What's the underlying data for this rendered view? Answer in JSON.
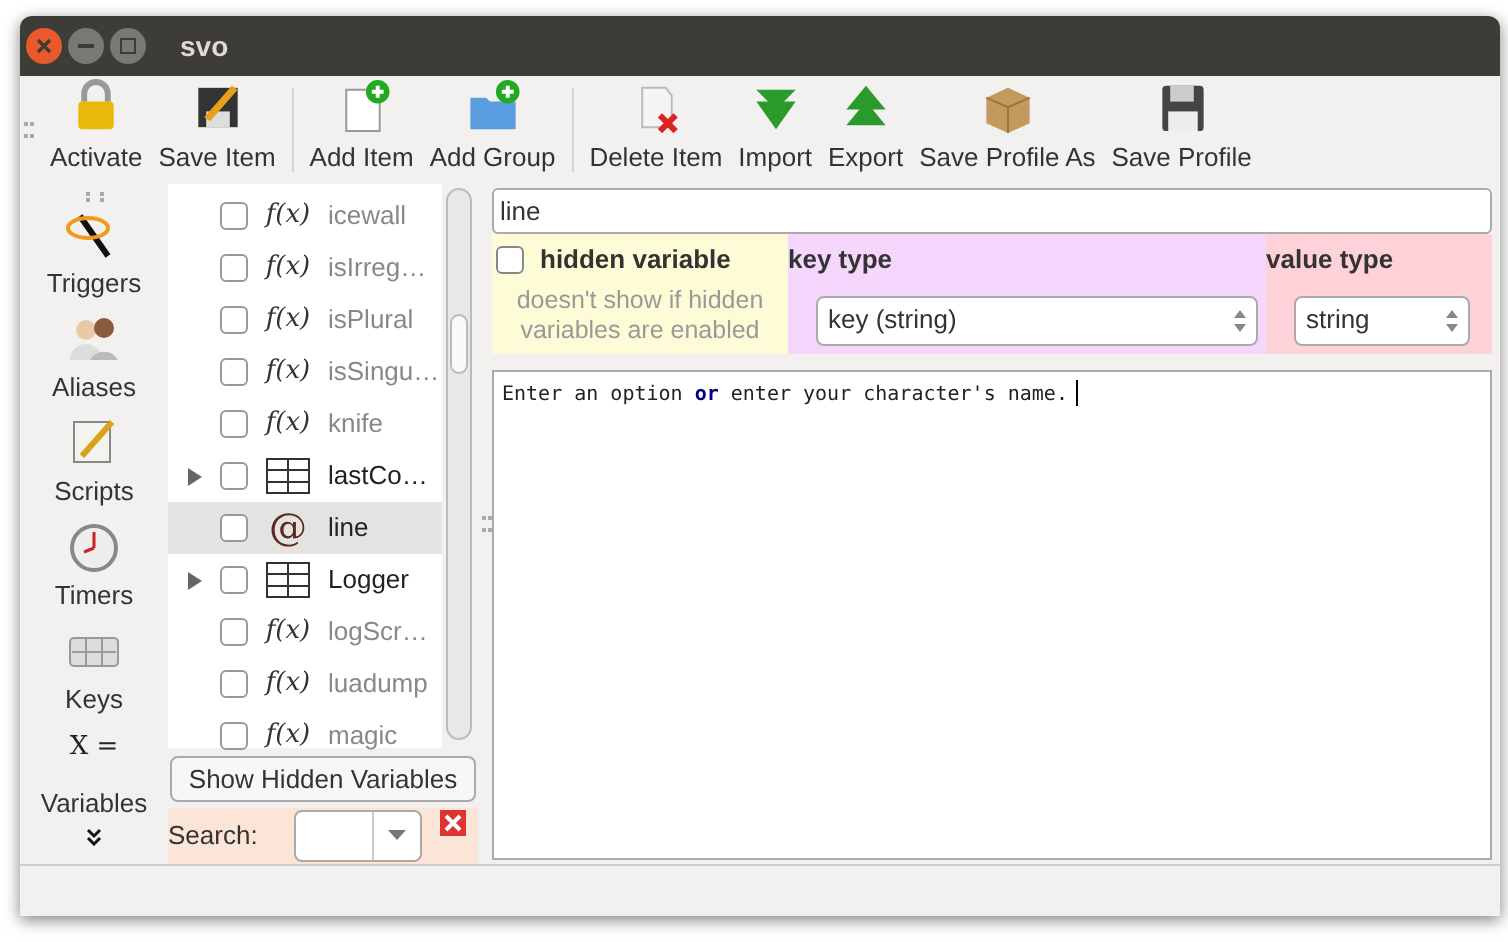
{
  "window": {
    "title": "svo"
  },
  "toolbar": [
    {
      "kind": "button",
      "label": "Activate"
    },
    {
      "kind": "button",
      "label": "Save Item"
    },
    {
      "kind": "separator"
    },
    {
      "kind": "button",
      "label": "Add Item"
    },
    {
      "kind": "button",
      "label": "Add Group"
    },
    {
      "kind": "separator"
    },
    {
      "kind": "button",
      "label": "Delete Item"
    },
    {
      "kind": "button",
      "label": "Import"
    },
    {
      "kind": "button",
      "label": "Export"
    },
    {
      "kind": "button",
      "label": "Save Profile As"
    },
    {
      "kind": "button",
      "label": "Save Profile"
    }
  ],
  "sidebar": {
    "items": [
      {
        "label": "Triggers"
      },
      {
        "label": "Aliases"
      },
      {
        "label": "Scripts"
      },
      {
        "label": "Timers"
      },
      {
        "label": "Keys"
      },
      {
        "label": "Variables",
        "icon_text": "X ="
      }
    ]
  },
  "tree": {
    "items": [
      {
        "name": "icewall",
        "kind": "function",
        "icon_text": "f(x)",
        "checked": false,
        "selected": false
      },
      {
        "name": "isIrreg…",
        "kind": "function",
        "icon_text": "f(x)",
        "checked": false,
        "selected": false
      },
      {
        "name": "isPlural",
        "kind": "function",
        "icon_text": "f(x)",
        "checked": false,
        "selected": false
      },
      {
        "name": "isSingu…",
        "kind": "function",
        "icon_text": "f(x)",
        "checked": false,
        "selected": false
      },
      {
        "name": "knife",
        "kind": "function",
        "icon_text": "f(x)",
        "checked": false,
        "selected": false
      },
      {
        "name": "lastCo…",
        "kind": "table",
        "expandable": true,
        "checked": false,
        "selected": false
      },
      {
        "name": "line",
        "kind": "string",
        "icon_text": "@",
        "checked": false,
        "selected": true
      },
      {
        "name": "Logger",
        "kind": "table",
        "expandable": true,
        "checked": false,
        "selected": false
      },
      {
        "name": "logScr…",
        "kind": "function",
        "icon_text": "f(x)",
        "checked": false,
        "selected": false
      },
      {
        "name": "luadump",
        "kind": "function",
        "icon_text": "f(x)",
        "checked": false,
        "selected": false
      },
      {
        "name": "magic",
        "kind": "function",
        "icon_text": "f(x)",
        "checked": false,
        "selected": false
      }
    ],
    "show_hidden_button": "Show Hidden Variables",
    "search_label": "Search:"
  },
  "editor": {
    "name_value": "line",
    "hidden_variable": {
      "label": "hidden variable",
      "checked": false,
      "hint": "doesn't show if hidden variables are enabled"
    },
    "key_type": {
      "label": "key type",
      "value": "key (string)"
    },
    "value_type": {
      "label": "value type",
      "value": "string"
    },
    "code": "Enter an option **or** enter your character's name."
  }
}
